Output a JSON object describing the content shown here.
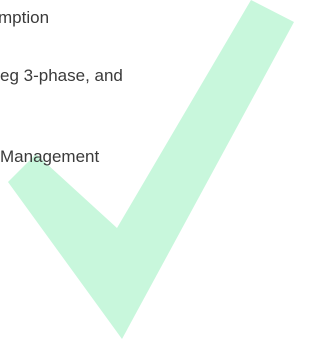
{
  "text_lines": [
    "mption",
    "eg 3-phase, and",
    "Management"
  ],
  "checkmark": {
    "icon": "checkmark-icon",
    "color": "#c8f7dc"
  },
  "background_color": "#ffffff",
  "text_color": "#3a3a3a"
}
